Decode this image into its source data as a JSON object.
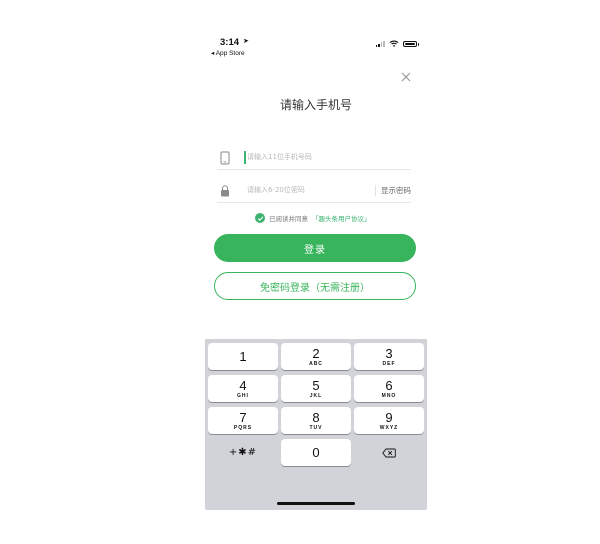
{
  "status_bar": {
    "time": "3:14",
    "back_label": "◂ App Store"
  },
  "title": "请输入手机号",
  "phone_field": {
    "placeholder": "请输入11位手机号码"
  },
  "password_field": {
    "placeholder": "请输入6-20位密码",
    "show_password_label": "显示密码"
  },
  "agreement": {
    "prefix": "已阅读并同意",
    "link": "「趣头条用户协议」"
  },
  "buttons": {
    "login": "登录",
    "passwordless_login": "免密码登录（无需注册）"
  },
  "keypad": {
    "keys": [
      {
        "num": "1",
        "letters": ""
      },
      {
        "num": "2",
        "letters": "ABC"
      },
      {
        "num": "3",
        "letters": "DEF"
      },
      {
        "num": "4",
        "letters": "GHI"
      },
      {
        "num": "5",
        "letters": "JKL"
      },
      {
        "num": "6",
        "letters": "MNO"
      },
      {
        "num": "7",
        "letters": "PQRS"
      },
      {
        "num": "8",
        "letters": "TUV"
      },
      {
        "num": "9",
        "letters": "WXYZ"
      },
      {
        "num": "0",
        "letters": ""
      }
    ],
    "symbols": "+✱#"
  },
  "colors": {
    "accent": "#37b45c",
    "keyboard_bg": "#d1d3d9"
  }
}
